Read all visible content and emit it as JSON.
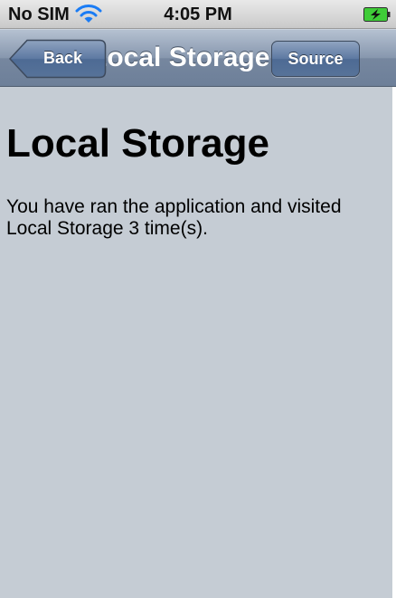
{
  "status_bar": {
    "carrier": "No SIM",
    "time": "4:05 PM",
    "wifi_icon": "wifi-icon",
    "battery_icon": "battery-charging-icon"
  },
  "nav_bar": {
    "title": "Local Storage",
    "back_label": "Back",
    "source_label": "Source",
    "color": "#8797ae"
  },
  "content": {
    "heading": "Local Storage",
    "message": "You have ran the application and visited Local Storage 3 time(s).",
    "background": "#c5ccd4"
  }
}
